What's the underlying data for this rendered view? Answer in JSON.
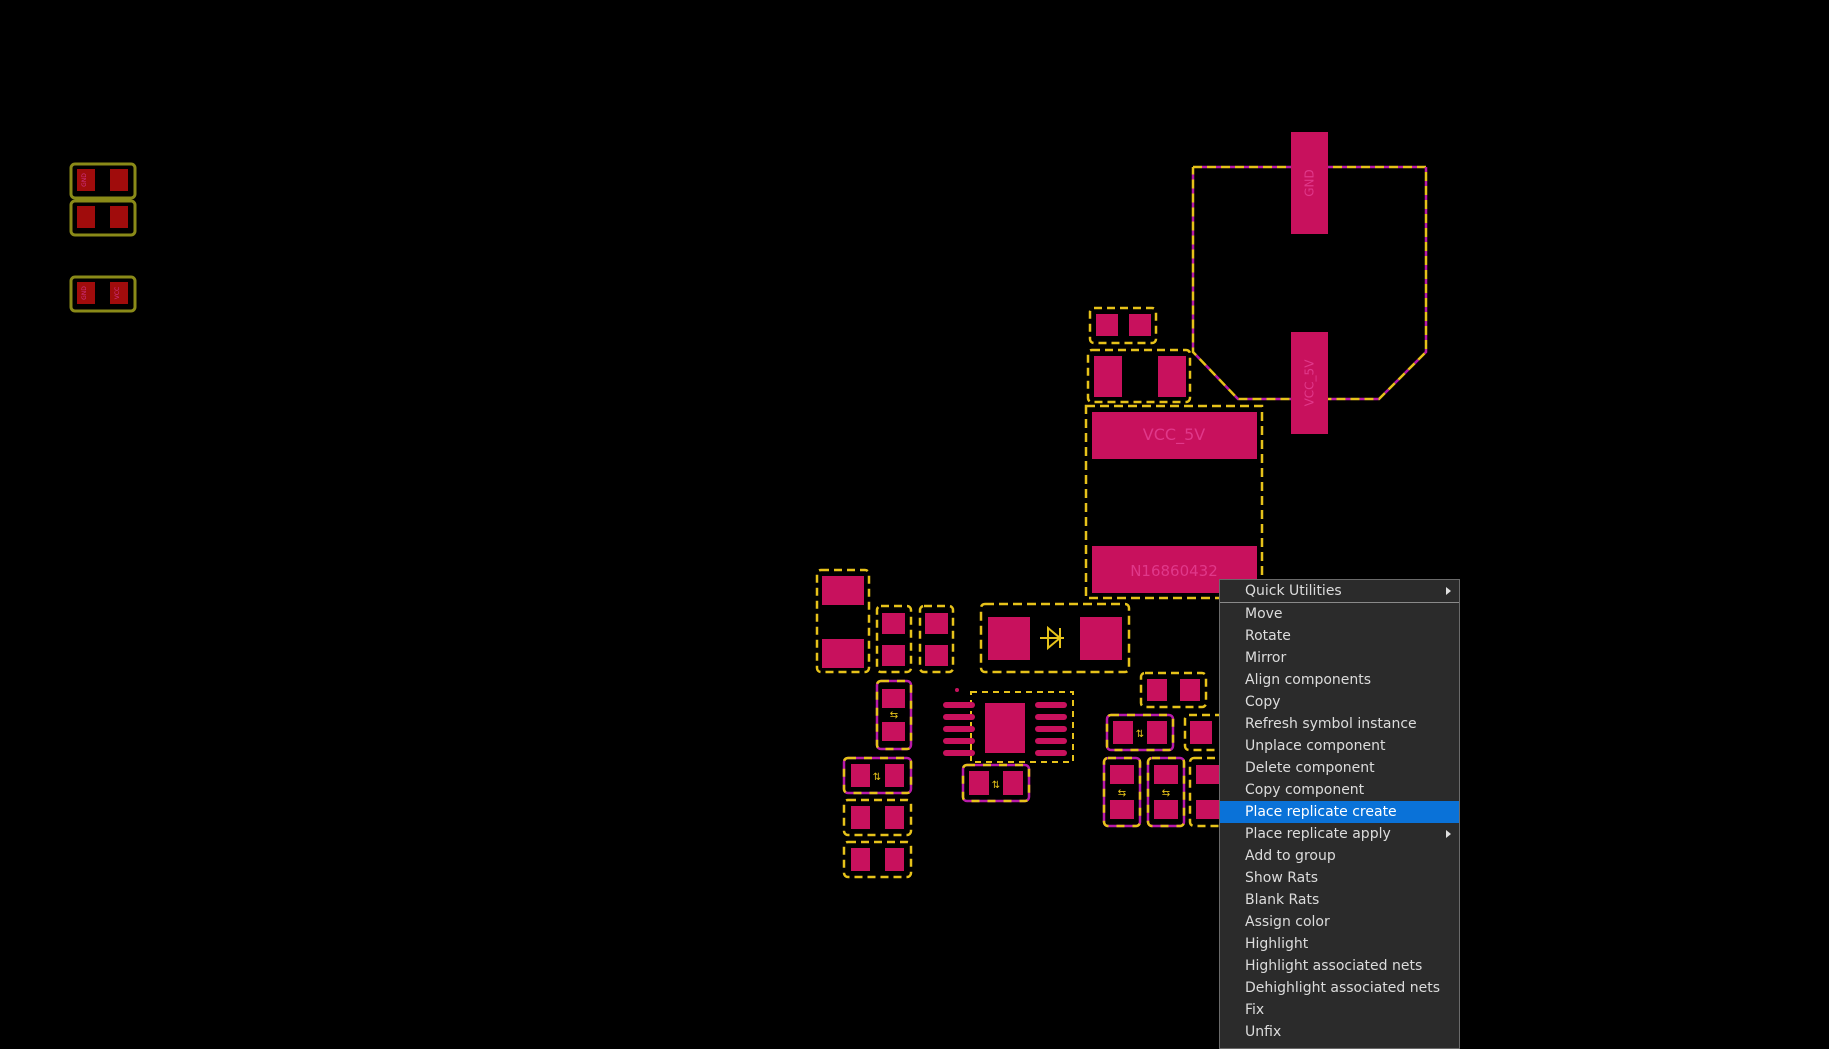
{
  "canvas": {
    "background": "#000000",
    "pad_fill": "#c8115d",
    "outline_color": "#e6c21a",
    "dash_color": "#b81aa8",
    "red_pad_fill": "#a00c0c",
    "component_labels": {
      "vcc_5v": "VCC_5V",
      "net_label": "N16860432",
      "vertical_top": "GND",
      "vertical_bottom": "VCC_5V",
      "small_pad_a": "GND",
      "small_pad_b": "VCC"
    }
  },
  "context_menu": {
    "items": [
      {
        "label": "Quick Utilities",
        "submenu": true,
        "separator_after": true
      },
      {
        "label": "Move"
      },
      {
        "label": "Rotate"
      },
      {
        "label": "Mirror"
      },
      {
        "label": "Align components"
      },
      {
        "label": "Copy"
      },
      {
        "label": "Refresh symbol instance"
      },
      {
        "label": "Unplace component"
      },
      {
        "label": "Delete component"
      },
      {
        "label": "Copy component"
      },
      {
        "label": "Place replicate create",
        "selected": true
      },
      {
        "label": "Place replicate apply",
        "submenu": true
      },
      {
        "label": "Add to group"
      },
      {
        "label": "Show Rats"
      },
      {
        "label": "Blank Rats"
      },
      {
        "label": "Assign color"
      },
      {
        "label": "Highlight"
      },
      {
        "label": "Highlight associated nets"
      },
      {
        "label": "Dehighlight associated nets"
      },
      {
        "label": "Fix"
      },
      {
        "label": "Unfix"
      }
    ]
  }
}
